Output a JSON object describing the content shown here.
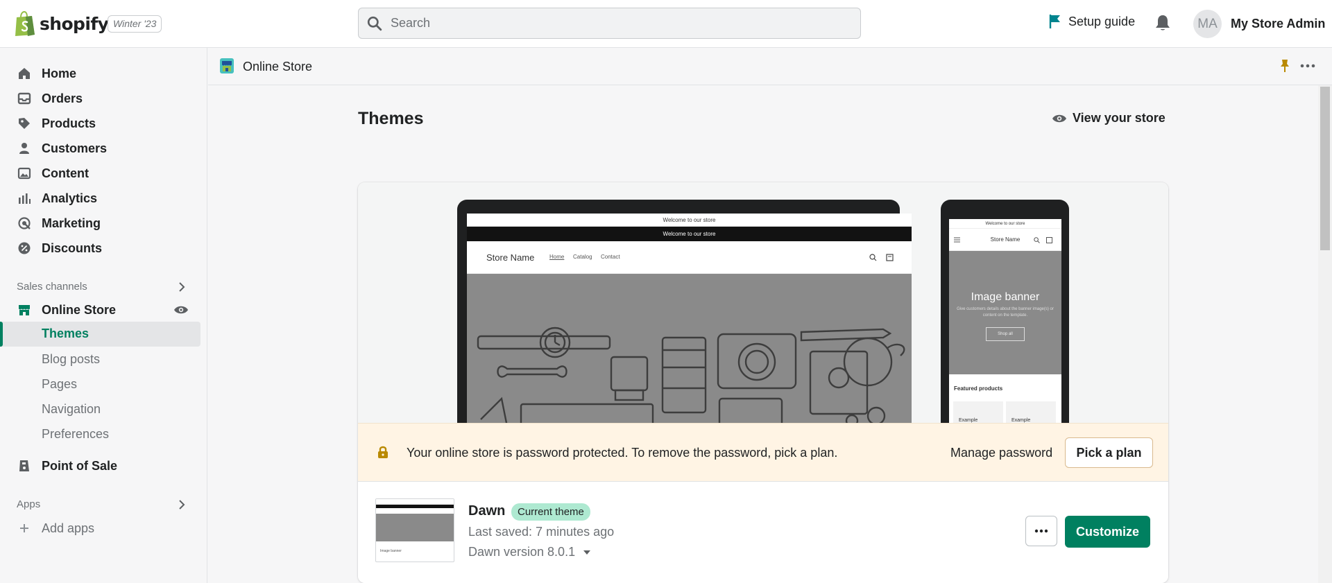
{
  "topbar": {
    "brand": "shopify",
    "edition": "Winter '23",
    "search_placeholder": "Search",
    "setup_guide": "Setup guide",
    "avatar_initials": "MA",
    "store_admin": "My Store Admin"
  },
  "sidebar": {
    "items": [
      {
        "label": "Home",
        "icon": "home-icon"
      },
      {
        "label": "Orders",
        "icon": "orders-icon"
      },
      {
        "label": "Products",
        "icon": "tag-icon"
      },
      {
        "label": "Customers",
        "icon": "person-icon"
      },
      {
        "label": "Content",
        "icon": "image-icon"
      },
      {
        "label": "Analytics",
        "icon": "bar-chart-icon"
      },
      {
        "label": "Marketing",
        "icon": "target-icon"
      },
      {
        "label": "Discounts",
        "icon": "discount-icon"
      }
    ],
    "sales_channels_label": "Sales channels",
    "online_store": "Online Store",
    "sub_items": [
      "Themes",
      "Blog posts",
      "Pages",
      "Navigation",
      "Preferences"
    ],
    "active_sub": "Themes",
    "point_of_sale": "Point of Sale",
    "apps_label": "Apps",
    "add_apps": "Add apps"
  },
  "crumb": {
    "title": "Online Store"
  },
  "main": {
    "title": "Themes",
    "view_store": "View your store"
  },
  "preview": {
    "announcement": "Welcome to our store",
    "store_name": "Store Name",
    "nav_links": [
      "Home",
      "Catalog",
      "Contact"
    ],
    "mobile_banner_title": "Image banner",
    "mobile_banner_text": "Give customers details about the banner image(s) or content on the template.",
    "mobile_shop_all": "Shop all",
    "featured_products": "Featured products",
    "example_label": "Example"
  },
  "banner": {
    "message": "Your online store is password protected. To remove the password, pick a plan.",
    "manage_password": "Manage password",
    "pick_plan": "Pick a plan"
  },
  "theme": {
    "name": "Dawn",
    "badge": "Current theme",
    "last_saved": "Last saved: 7 minutes ago",
    "version": "Dawn version 8.0.1",
    "customize": "Customize",
    "thumb_label": "Image banner"
  },
  "colors": {
    "accent": "#008060",
    "badge_bg": "#aee9d1",
    "banner_bg": "#fff4e4",
    "setup_flag": "#00848e",
    "lock": "#b98900"
  }
}
